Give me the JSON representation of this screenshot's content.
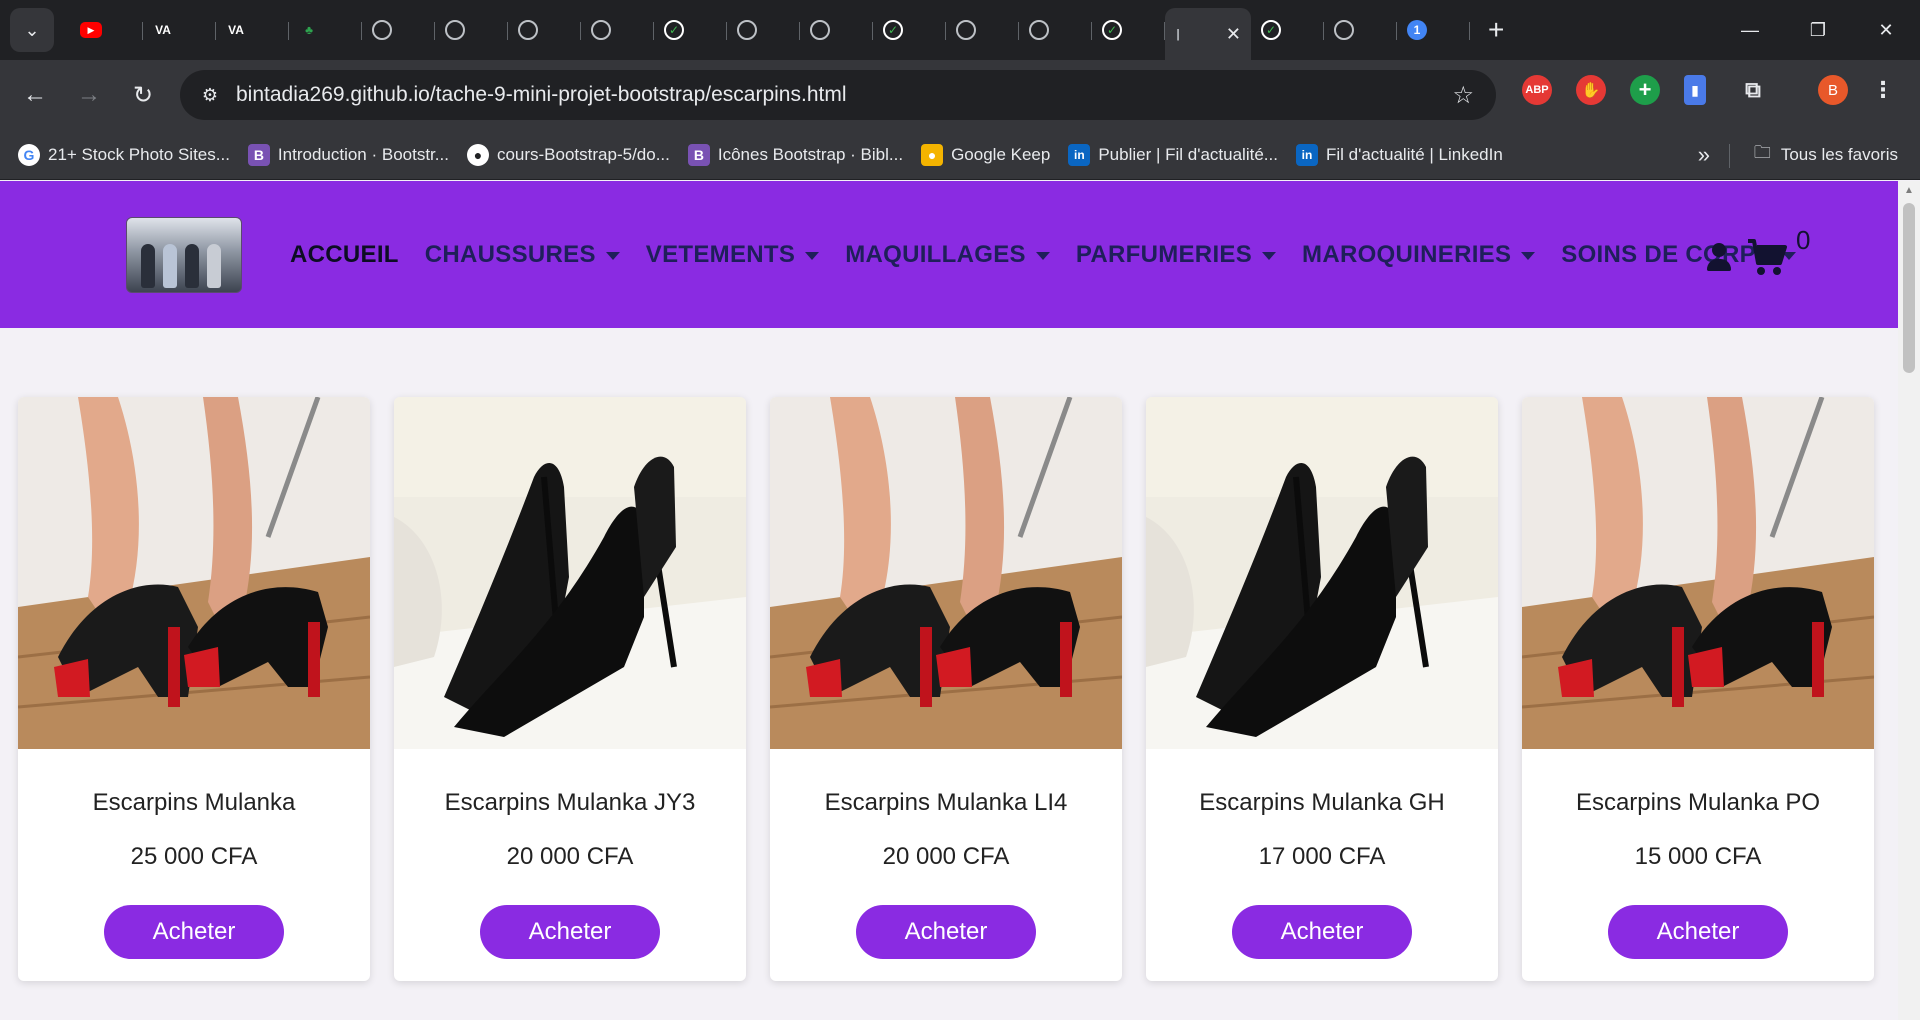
{
  "browser": {
    "url": "bintadia269.github.io/tache-9-mini-projet-bootstrap/escarpins.html",
    "profile_initial": "B",
    "extensions": {
      "adblock": "ABP"
    },
    "bookmarks": [
      {
        "label": "21+ Stock Photo Sites...",
        "icon": "google-icon",
        "color": "#ffffff",
        "glyph": "G"
      },
      {
        "label": "Introduction · Bootstr...",
        "icon": "bootstrap-icon",
        "color": "#7952b3",
        "glyph": "B"
      },
      {
        "label": "cours-Bootstrap-5/do...",
        "icon": "github-icon",
        "color": "#ffffff",
        "glyph": "●"
      },
      {
        "label": "Icônes Bootstrap · Bibl...",
        "icon": "bootstrap-icon",
        "color": "#7952b3",
        "glyph": "B"
      },
      {
        "label": "Google Keep",
        "icon": "keep-icon",
        "color": "#f4b400",
        "glyph": "●"
      },
      {
        "label": "Publier | Fil d'actualité...",
        "icon": "linkedin-icon",
        "color": "#0a66c2",
        "glyph": "in"
      },
      {
        "label": "Fil d'actualité | LinkedIn",
        "icon": "linkedin-icon",
        "color": "#0a66c2",
        "glyph": "in"
      }
    ],
    "all_bookmarks": "Tous les favoris"
  },
  "nav": {
    "home": "ACCUEIL",
    "items": [
      "CHAUSSURES",
      "VETEMENTS",
      "MAQUILLAGES",
      "PARFUMERIES",
      "MAROQUINERIES",
      "SOINS DE CORPS"
    ],
    "cart_count": "0",
    "accent": "#8a2be2"
  },
  "products": [
    {
      "name": "Escarpins Mulanka",
      "price": "25 000 CFA",
      "button": "Acheter",
      "image": "red-sole-peep-toe-pumps"
    },
    {
      "name": "Escarpins Mulanka JY3",
      "price": "20 000 CFA",
      "button": "Acheter",
      "image": "black-pointed-pumps"
    },
    {
      "name": "Escarpins Mulanka LI4",
      "price": "20 000 CFA",
      "button": "Acheter",
      "image": "red-sole-peep-toe-pumps"
    },
    {
      "name": "Escarpins Mulanka GH",
      "price": "17 000 CFA",
      "button": "Acheter",
      "image": "black-pointed-pumps"
    },
    {
      "name": "Escarpins Mulanka PO",
      "price": "15 000 CFA",
      "button": "Acheter",
      "image": "red-sole-peep-toe-pumps"
    }
  ]
}
